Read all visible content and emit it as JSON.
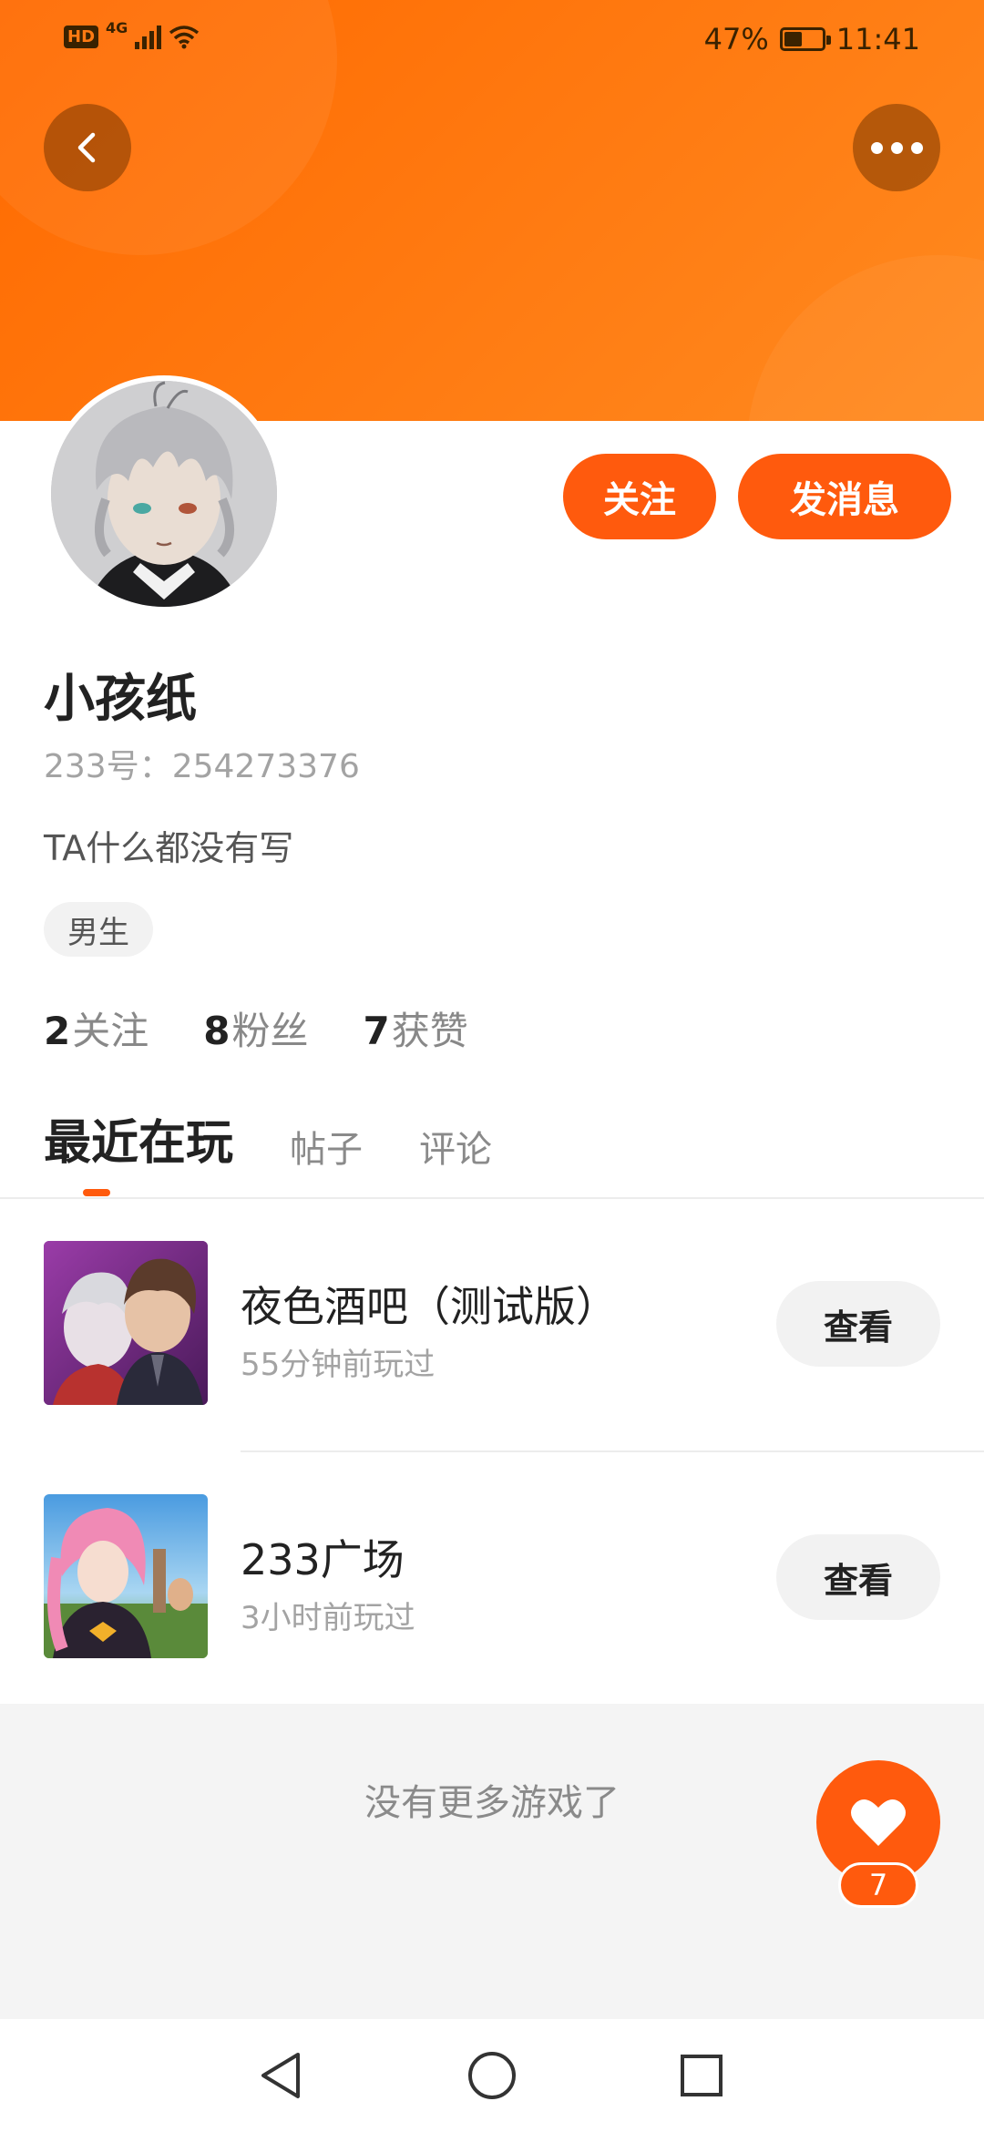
{
  "status_bar": {
    "hd_label": "HD",
    "network_label": "4G",
    "battery_percent": 47,
    "battery_text": "47%",
    "time": "11:41"
  },
  "header": {
    "back_icon": "chevron-left-icon",
    "more_icon": "more-dots-icon",
    "gradient_colors": [
      "#ff6a00",
      "#ff8a1f"
    ]
  },
  "profile": {
    "follow_label": "关注",
    "message_label": "发消息",
    "username": "小孩纸",
    "user_id": "233号：254273376",
    "bio": "TA什么都没有写",
    "gender_tag": "男生",
    "accent_color": "#ff5a0d"
  },
  "stats": [
    {
      "value": "2",
      "label": "关注"
    },
    {
      "value": "8",
      "label": "粉丝"
    },
    {
      "value": "7",
      "label": "获赞"
    }
  ],
  "tabs": [
    {
      "label": "最近在玩",
      "active": true
    },
    {
      "label": "帖子",
      "active": false
    },
    {
      "label": "评论",
      "active": false
    }
  ],
  "games": [
    {
      "title": "夜色酒吧（测试版）",
      "subtitle": "55分钟前玩过",
      "button": "查看"
    },
    {
      "title": "233广场",
      "subtitle": "3小时前玩过",
      "button": "查看"
    }
  ],
  "footer": {
    "no_more_text": "没有更多游戏了",
    "like_icon": "heart-icon",
    "like_count": "7"
  },
  "navbar": {
    "back_icon": "nav-back-icon",
    "home_icon": "nav-home-icon",
    "recents_icon": "nav-recents-icon"
  }
}
